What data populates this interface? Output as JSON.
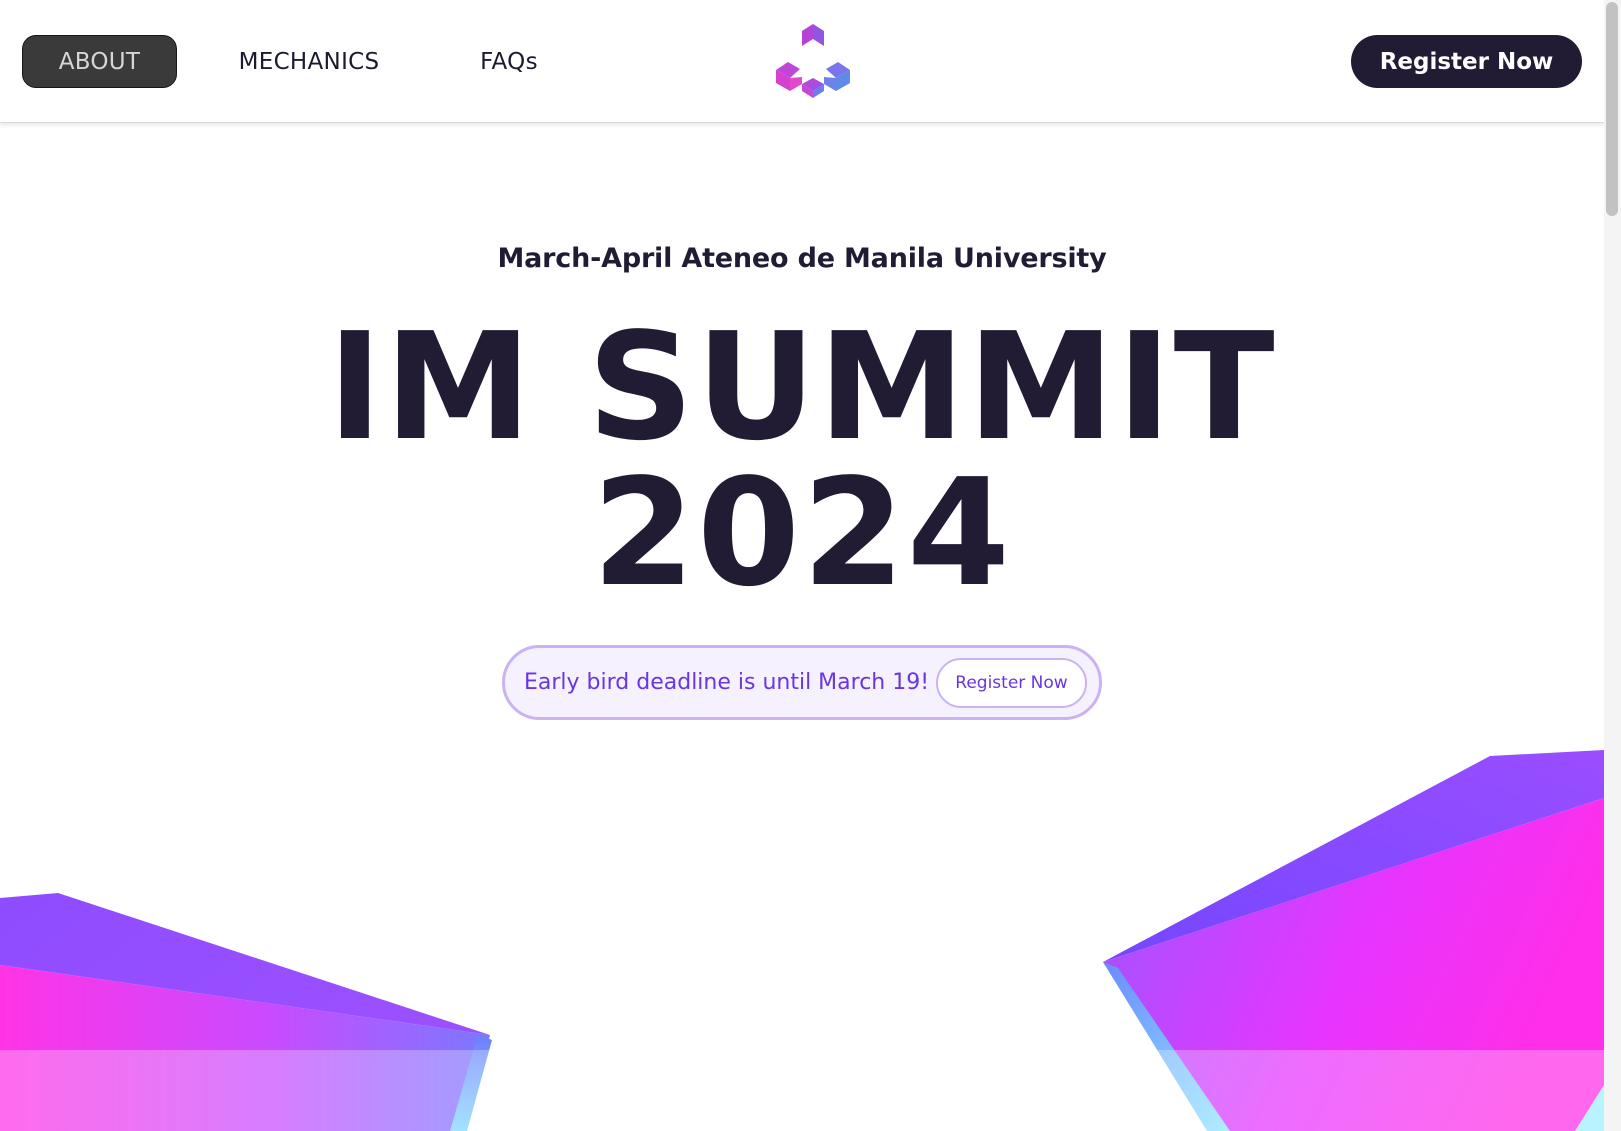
{
  "nav": {
    "links": [
      {
        "label": "ABOUT",
        "active": true
      },
      {
        "label": "MECHANICS",
        "active": false
      },
      {
        "label": "FAQs",
        "active": false
      }
    ],
    "register_label": "Register Now",
    "logo_icon": "triangle-cube-logo-icon"
  },
  "hero": {
    "subtitle": "March-April Ateneo de Manila University",
    "title_line1": "IM SUMMIT",
    "title_line2": "2024",
    "early_bird_text": "Early bird deadline is until March 19!",
    "early_bird_button": "Register Now"
  },
  "colors": {
    "navy": "#211c34",
    "accent_purple": "#6a36e0",
    "pill_border": "#cbb3f3",
    "gradient_violet": "#8a4bff",
    "gradient_magenta": "#ff2ee8",
    "gradient_blue": "#6fb6ff"
  }
}
